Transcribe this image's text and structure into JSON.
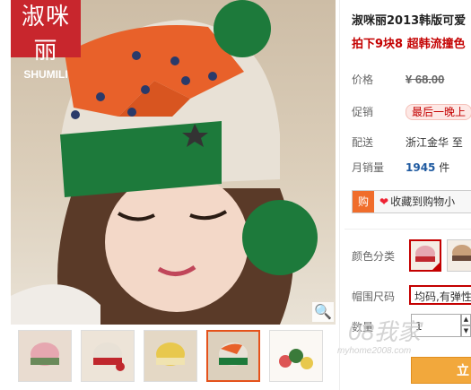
{
  "brand": {
    "cn": "淑咪丽",
    "en": "SHUMILI"
  },
  "photo": {
    "alt": "Woman wearing knitted pompom beanie",
    "zoom_icon": "magnifier-icon"
  },
  "thumbnails": [
    {
      "name": "thumb-1",
      "hat_color": "#e6a7b0",
      "accent": "#6a8a5a"
    },
    {
      "name": "thumb-2",
      "hat_color": "#e8e1d6",
      "accent": "#c0272d"
    },
    {
      "name": "thumb-3",
      "hat_color": "#e8c84d",
      "accent": "#f0e3b0"
    },
    {
      "name": "thumb-4",
      "hat_color": "#e8612a",
      "accent": "#1d7a3b"
    },
    {
      "name": "thumb-5",
      "hat_color": "#f2ece5",
      "accent": "#d55"
    }
  ],
  "product": {
    "title": "淑咪丽2013韩版可爱",
    "promo": "拍下9块8 超韩流撞色"
  },
  "fields": {
    "price_label": "价格",
    "price_value": "¥ 68.00",
    "promo_label": "促销",
    "promo_tag": "最后一晚上",
    "ship_label": "配送",
    "ship_value": "浙江金华  至",
    "sales_label": "月销量",
    "sales_value": "1945",
    "sales_unit": "件"
  },
  "favorite": {
    "icon": "cart-icon",
    "icon_text": "购",
    "heart": "❤",
    "label": "收藏到购物小"
  },
  "options": {
    "color_label": "颜色分类",
    "size_label": "帽围尺码",
    "size_value": "均码,有弹性",
    "qty_label": "数量",
    "qty_value": "1"
  },
  "buy_button": {
    "label": "立"
  },
  "watermark": {
    "main": "08我家",
    "sub": "myhome2008.com"
  },
  "colors": {
    "accent": "#c40000",
    "brand_red": "#c8262d",
    "orange": "#f2a83c"
  }
}
